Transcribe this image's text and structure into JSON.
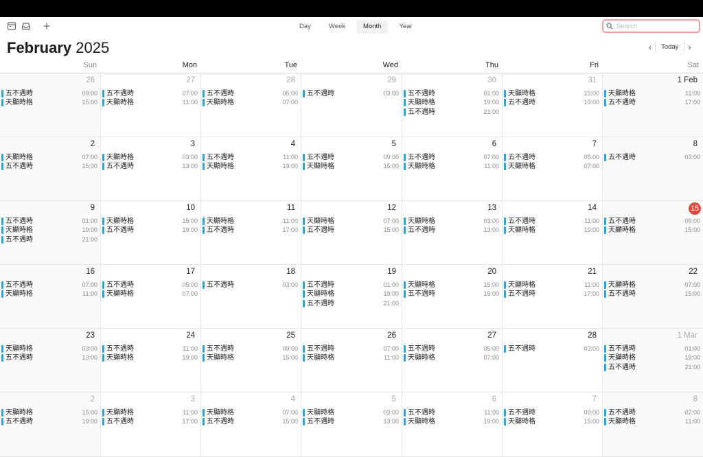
{
  "toolbar": {
    "icons": [
      "calendar-list-icon",
      "inbox-icon",
      "plus-icon"
    ],
    "views": [
      {
        "label": "Day",
        "active": false
      },
      {
        "label": "Week",
        "active": false
      },
      {
        "label": "Month",
        "active": true
      },
      {
        "label": "Year",
        "active": false
      }
    ],
    "search": {
      "placeholder": "Search",
      "value": ""
    }
  },
  "header": {
    "month": "February",
    "year": "2025",
    "prev": "‹",
    "today_label": "Today",
    "next": "›"
  },
  "weekdays": [
    "Sun",
    "Mon",
    "Tue",
    "Wed",
    "Thu",
    "Fri",
    "Sat"
  ],
  "colors": {
    "event_accent": "#2aa5db",
    "today": "#e8453c",
    "search_focus": "#f0a0a0"
  },
  "weeks": [
    [
      {
        "label": "26",
        "dim": true,
        "events": [
          {
            "t": "五不遇時",
            "h": "09:00"
          },
          {
            "t": "天顯時格",
            "h": "15:00"
          }
        ]
      },
      {
        "label": "27",
        "dim": true,
        "events": [
          {
            "t": "五不遇時",
            "h": "07:00"
          },
          {
            "t": "天顯時格",
            "h": "11:00"
          }
        ]
      },
      {
        "label": "28",
        "dim": true,
        "events": [
          {
            "t": "五不遇時",
            "h": "05:00"
          },
          {
            "t": "天顯時格",
            "h": "07:00"
          }
        ]
      },
      {
        "label": "29",
        "dim": true,
        "events": [
          {
            "t": "五不遇時",
            "h": "03:00"
          }
        ]
      },
      {
        "label": "30",
        "dim": true,
        "events": [
          {
            "t": "五不遇時",
            "h": "01:00"
          },
          {
            "t": "天顯時格",
            "h": "19:00"
          },
          {
            "t": "五不遇時",
            "h": "21:00"
          }
        ]
      },
      {
        "label": "31",
        "dim": true,
        "events": [
          {
            "t": "天顯時格",
            "h": "15:00"
          },
          {
            "t": "五不遇時",
            "h": "19:00"
          }
        ]
      },
      {
        "label": "1 Feb",
        "events": [
          {
            "t": "天顯時格",
            "h": "11:00"
          },
          {
            "t": "五不遇時",
            "h": "17:00"
          }
        ]
      }
    ],
    [
      {
        "label": "2",
        "events": [
          {
            "t": "天顯時格",
            "h": "07:00"
          },
          {
            "t": "五不遇時",
            "h": "15:00"
          }
        ]
      },
      {
        "label": "3",
        "events": [
          {
            "t": "天顯時格",
            "h": "03:00"
          },
          {
            "t": "五不遇時",
            "h": "13:00"
          }
        ]
      },
      {
        "label": "4",
        "events": [
          {
            "t": "五不遇時",
            "h": "11:00"
          },
          {
            "t": "天顯時格",
            "h": "19:00"
          }
        ]
      },
      {
        "label": "5",
        "events": [
          {
            "t": "五不遇時",
            "h": "09:00"
          },
          {
            "t": "天顯時格",
            "h": "15:00"
          }
        ]
      },
      {
        "label": "6",
        "events": [
          {
            "t": "五不遇時",
            "h": "07:00"
          },
          {
            "t": "天顯時格",
            "h": "11:00"
          }
        ]
      },
      {
        "label": "7",
        "events": [
          {
            "t": "五不遇時",
            "h": "05:00"
          },
          {
            "t": "天顯時格",
            "h": "07:00"
          }
        ]
      },
      {
        "label": "8",
        "events": [
          {
            "t": "五不遇時",
            "h": "03:00"
          }
        ]
      }
    ],
    [
      {
        "label": "9",
        "events": [
          {
            "t": "五不遇時",
            "h": "01:00"
          },
          {
            "t": "天顯時格",
            "h": "19:00"
          },
          {
            "t": "五不遇時",
            "h": "21:00"
          }
        ]
      },
      {
        "label": "10",
        "events": [
          {
            "t": "天顯時格",
            "h": "15:00"
          },
          {
            "t": "五不遇時",
            "h": "19:00"
          }
        ]
      },
      {
        "label": "11",
        "events": [
          {
            "t": "天顯時格",
            "h": "11:00"
          },
          {
            "t": "五不遇時",
            "h": "17:00"
          }
        ]
      },
      {
        "label": "12",
        "events": [
          {
            "t": "天顯時格",
            "h": "07:00"
          },
          {
            "t": "五不遇時",
            "h": "15:00"
          }
        ]
      },
      {
        "label": "13",
        "events": [
          {
            "t": "天顯時格",
            "h": "03:00"
          },
          {
            "t": "五不遇時",
            "h": "13:00"
          }
        ]
      },
      {
        "label": "14",
        "events": [
          {
            "t": "五不遇時",
            "h": "11:00"
          },
          {
            "t": "天顯時格",
            "h": "19:00"
          }
        ]
      },
      {
        "label": "15",
        "today": true,
        "events": [
          {
            "t": "五不遇時",
            "h": "09:00"
          },
          {
            "t": "天顯時格",
            "h": "15:00"
          }
        ]
      }
    ],
    [
      {
        "label": "16",
        "events": [
          {
            "t": "五不遇時",
            "h": "07:00"
          },
          {
            "t": "天顯時格",
            "h": "11:00"
          }
        ]
      },
      {
        "label": "17",
        "events": [
          {
            "t": "五不遇時",
            "h": "05:00"
          },
          {
            "t": "天顯時格",
            "h": "07:00"
          }
        ]
      },
      {
        "label": "18",
        "events": [
          {
            "t": "五不遇時",
            "h": "03:00"
          }
        ]
      },
      {
        "label": "19",
        "events": [
          {
            "t": "五不遇時",
            "h": "01:00"
          },
          {
            "t": "天顯時格",
            "h": "19:00"
          },
          {
            "t": "五不遇時",
            "h": "21:00"
          }
        ]
      },
      {
        "label": "20",
        "events": [
          {
            "t": "天顯時格",
            "h": "15:00"
          },
          {
            "t": "五不遇時",
            "h": "19:00"
          }
        ]
      },
      {
        "label": "21",
        "events": [
          {
            "t": "天顯時格",
            "h": "11:00"
          },
          {
            "t": "五不遇時",
            "h": "17:00"
          }
        ]
      },
      {
        "label": "22",
        "events": [
          {
            "t": "天顯時格",
            "h": "07:00"
          },
          {
            "t": "五不遇時",
            "h": "15:00"
          }
        ]
      }
    ],
    [
      {
        "label": "23",
        "events": [
          {
            "t": "天顯時格",
            "h": "03:00"
          },
          {
            "t": "五不遇時",
            "h": "13:00"
          }
        ]
      },
      {
        "label": "24",
        "events": [
          {
            "t": "五不遇時",
            "h": "11:00"
          },
          {
            "t": "天顯時格",
            "h": "19:00"
          }
        ]
      },
      {
        "label": "25",
        "events": [
          {
            "t": "五不遇時",
            "h": "09:00"
          },
          {
            "t": "天顯時格",
            "h": "15:00"
          }
        ]
      },
      {
        "label": "26",
        "events": [
          {
            "t": "五不遇時",
            "h": "07:00"
          },
          {
            "t": "天顯時格",
            "h": "11:00"
          }
        ]
      },
      {
        "label": "27",
        "events": [
          {
            "t": "五不遇時",
            "h": "05:00"
          },
          {
            "t": "天顯時格",
            "h": "07:00"
          }
        ]
      },
      {
        "label": "28",
        "events": [
          {
            "t": "五不遇時",
            "h": "03:00"
          }
        ]
      },
      {
        "label": "1 Mar",
        "dim": true,
        "events": [
          {
            "t": "五不遇時",
            "h": "01:00"
          },
          {
            "t": "天顯時格",
            "h": "19:00"
          },
          {
            "t": "五不遇時",
            "h": "21:00"
          }
        ]
      }
    ],
    [
      {
        "label": "2",
        "dim": true,
        "events": [
          {
            "t": "天顯時格",
            "h": "15:00"
          },
          {
            "t": "五不遇時",
            "h": "19:00"
          }
        ]
      },
      {
        "label": "3",
        "dim": true,
        "events": [
          {
            "t": "天顯時格",
            "h": "11:00"
          },
          {
            "t": "五不遇時",
            "h": "17:00"
          }
        ]
      },
      {
        "label": "4",
        "dim": true,
        "events": [
          {
            "t": "天顯時格",
            "h": "07:00"
          },
          {
            "t": "五不遇時",
            "h": "15:00"
          }
        ]
      },
      {
        "label": "5",
        "dim": true,
        "events": [
          {
            "t": "天顯時格",
            "h": "03:00"
          },
          {
            "t": "五不遇時",
            "h": "13:00"
          }
        ]
      },
      {
        "label": "6",
        "dim": true,
        "events": [
          {
            "t": "五不遇時",
            "h": "11:00"
          },
          {
            "t": "天顯時格",
            "h": "19:00"
          }
        ]
      },
      {
        "label": "7",
        "dim": true,
        "events": [
          {
            "t": "五不遇時",
            "h": "09:00"
          },
          {
            "t": "天顯時格",
            "h": "15:00"
          }
        ]
      },
      {
        "label": "8",
        "dim": true,
        "events": [
          {
            "t": "五不遇時",
            "h": "07:00"
          },
          {
            "t": "天顯時格",
            "h": "11:00"
          }
        ]
      }
    ]
  ]
}
